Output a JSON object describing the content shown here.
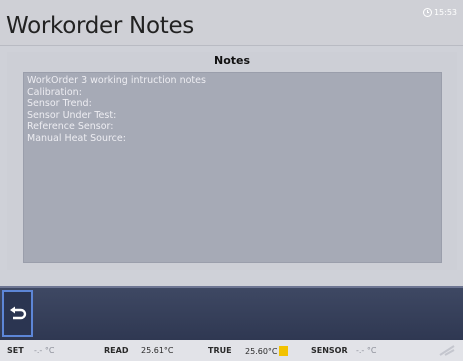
{
  "header": {
    "title": "Workorder Notes",
    "time": "15:53"
  },
  "panel": {
    "title": "Notes",
    "lines": [
      "WorkOrder 3 working intruction notes",
      "Calibration:",
      "Sensor Trend:",
      "Sensor Under Test:",
      "Reference Sensor:",
      "Manual Heat Source:"
    ]
  },
  "toolbar": {
    "back_icon": "return-arrow-icon"
  },
  "status": {
    "set_label": "SET",
    "set_value": "-.- °C",
    "read_label": "READ",
    "read_value": "25.61°C",
    "true_label": "TRUE",
    "true_value": "25.60°C",
    "sensor_label": "SENSOR",
    "sensor_value": "-.- °C"
  },
  "colors": {
    "toolbar_bg": "#333c57",
    "notes_bg": "#a6aab6",
    "badge": "#f2c200",
    "selected_outline": "#5d86d7"
  }
}
